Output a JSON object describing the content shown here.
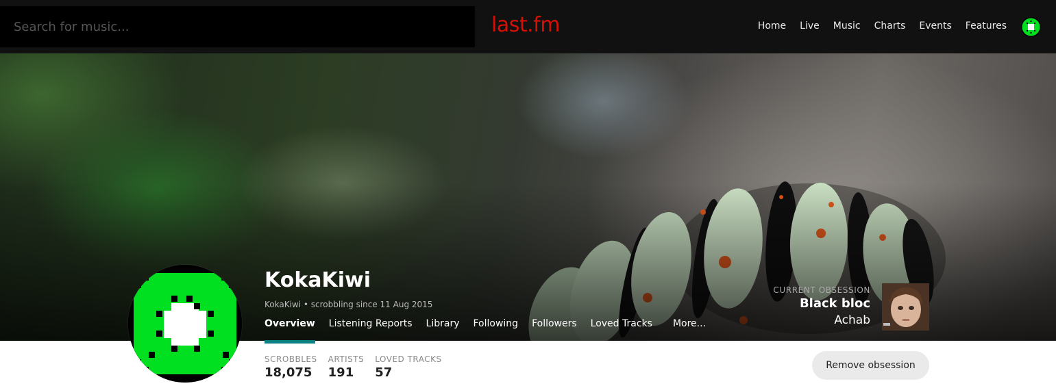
{
  "header": {
    "search_placeholder": "Search for music...",
    "logo_text": "last.fm",
    "nav_items": [
      "Home",
      "Live",
      "Music",
      "Charts",
      "Events",
      "Features"
    ]
  },
  "profile": {
    "username": "KokaKiwi",
    "subtitle": "KokaKiwi • scrobbling since 11 Aug 2015",
    "tabs": [
      "Overview",
      "Listening Reports",
      "Library",
      "Following",
      "Followers",
      "Loved Tracks",
      "More..."
    ],
    "active_tab": "Overview"
  },
  "obsession": {
    "label": "CURRENT OBSESSION",
    "track": "Black bloc",
    "artist": "Achab",
    "remove_label": "Remove obsession"
  },
  "stats": [
    {
      "label": "SCROBBLES",
      "value": "18,075"
    },
    {
      "label": "ARTISTS",
      "value": "191"
    },
    {
      "label": "LOVED TRACKS",
      "value": "57"
    }
  ],
  "colors": {
    "brand_red": "#d51007",
    "active_tab_underline": "#0c8181",
    "kiwi_green": "#00e020"
  }
}
